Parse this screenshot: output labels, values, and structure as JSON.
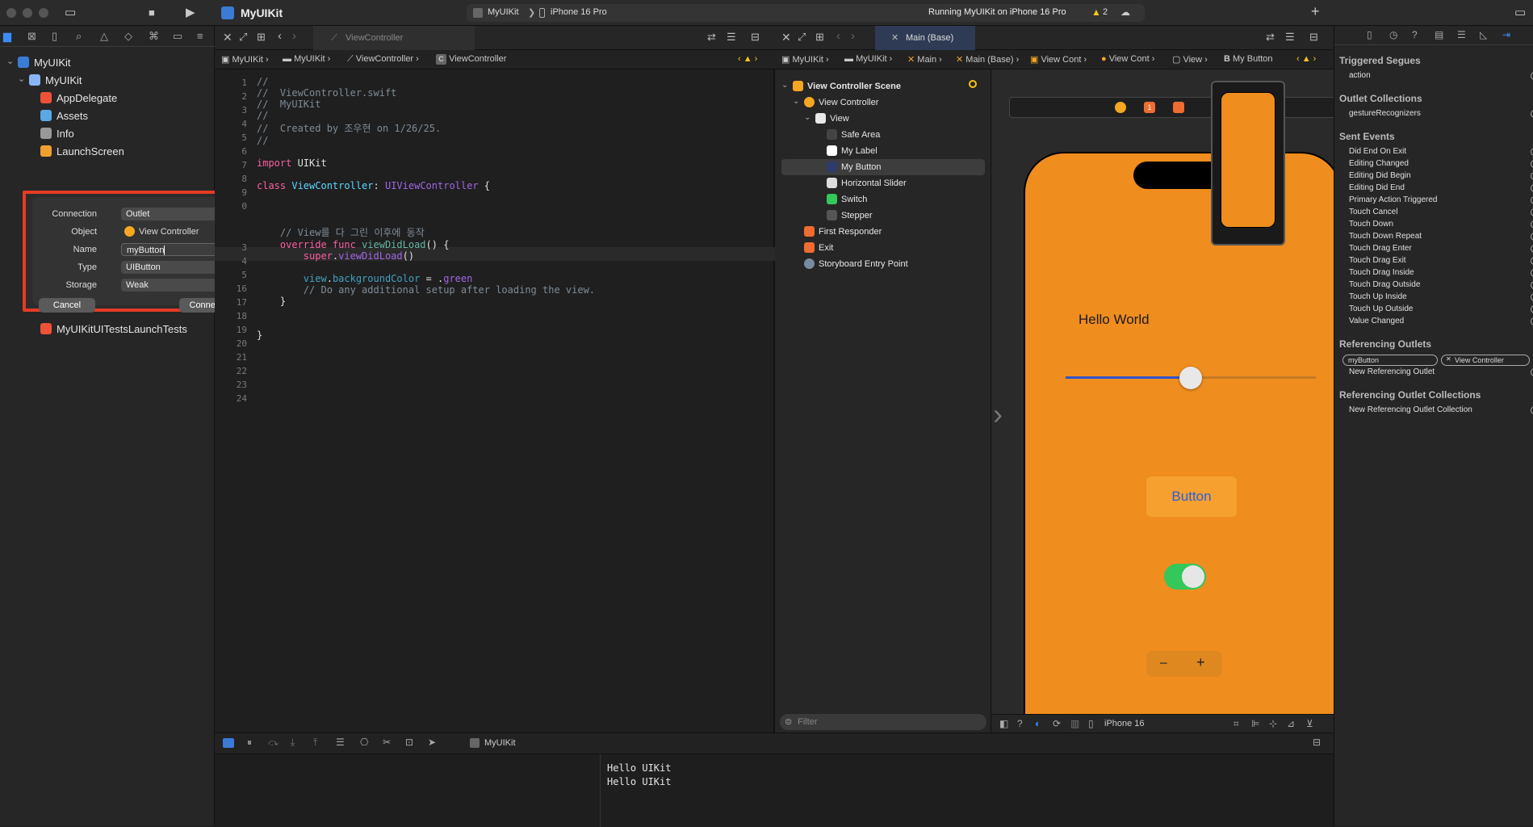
{
  "toolbar": {
    "project": "MyUIKit",
    "scheme": "MyUIKit",
    "device": "iPhone 16 Pro",
    "status": "Running MyUIKit on iPhone 16 Pro",
    "warnings": "2"
  },
  "navigator": {
    "items": [
      {
        "label": "MyUIKit",
        "icon": "project-icon",
        "color": "#3a7bd5"
      },
      {
        "label": "MyUIKit",
        "icon": "folder-icon",
        "color": "#8ab4f8"
      },
      {
        "label": "AppDelegate",
        "icon": "swift-icon",
        "color": "#f05138"
      },
      {
        "label": "Assets",
        "icon": "assets-icon",
        "color": "#5aa9e6"
      },
      {
        "label": "Info",
        "icon": "plist-icon",
        "color": "#999999"
      },
      {
        "label": "LaunchScreen",
        "icon": "storyboard-icon",
        "color": "#f0a030"
      },
      {
        "label": "MyUIKitUITestsLaunchTests",
        "icon": "swift-icon",
        "color": "#f05138"
      }
    ]
  },
  "popup": {
    "connection_label": "Connection",
    "connection_value": "Outlet",
    "object_label": "Object",
    "object_value": "View Controller",
    "name_label": "Name",
    "name_value": "myButton",
    "type_label": "Type",
    "type_value": "UIButton",
    "storage_label": "Storage",
    "storage_value": "Weak",
    "cancel": "Cancel",
    "connect": "Connect"
  },
  "editor": {
    "tab": "ViewController",
    "breadcrumb": [
      "MyUIKit",
      "MyUIKit",
      "ViewController",
      "ViewController"
    ],
    "line_numbers": [
      "1",
      "2",
      "3",
      "4",
      "5",
      "6",
      "7",
      "8",
      "9",
      "0",
      "",
      "",
      "3",
      "4",
      "5",
      "16",
      "17",
      "18",
      "19",
      "20",
      "21",
      "22",
      "23",
      "24"
    ]
  },
  "ib": {
    "tab": "Main (Base)",
    "breadcrumb": [
      "MyUIKit",
      "MyUIKit",
      "Main",
      "Main (Base)",
      "View Cont",
      "View Cont",
      "View",
      "My Button"
    ],
    "outline": [
      {
        "label": "View Controller Scene",
        "indent": 0,
        "bold": true
      },
      {
        "label": "View Controller",
        "indent": 1
      },
      {
        "label": "View",
        "indent": 2
      },
      {
        "label": "Safe Area",
        "indent": 3
      },
      {
        "label": "My Label",
        "indent": 3
      },
      {
        "label": "My Button",
        "indent": 3,
        "selected": true
      },
      {
        "label": "Horizontal Slider",
        "indent": 3
      },
      {
        "label": "Switch",
        "indent": 3
      },
      {
        "label": "Stepper",
        "indent": 3
      },
      {
        "label": "First Responder",
        "indent": 1
      },
      {
        "label": "Exit",
        "indent": 1
      },
      {
        "label": "Storyboard Entry Point",
        "indent": 1
      }
    ],
    "filter_placeholder": "Filter",
    "label_text": "Hello World",
    "button_text": "Button",
    "slider_value": 0.5,
    "switch_on": true,
    "stepper_minus": "−",
    "stepper_plus": "+",
    "device_label": "iPhone 16",
    "accent": "#ef8d1e"
  },
  "inspector": {
    "sections": [
      {
        "title": "Triggered Segues",
        "rows": [
          "action"
        ]
      },
      {
        "title": "Outlet Collections",
        "rows": [
          "gestureRecognizers"
        ]
      },
      {
        "title": "Sent Events",
        "rows": [
          "Did End On Exit",
          "Editing Changed",
          "Editing Did Begin",
          "Editing Did End",
          "Primary Action Triggered",
          "Touch Cancel",
          "Touch Down",
          "Touch Down Repeat",
          "Touch Drag Enter",
          "Touch Drag Exit",
          "Touch Drag Inside",
          "Touch Drag Outside",
          "Touch Up Inside",
          "Touch Up Outside",
          "Value Changed"
        ]
      },
      {
        "title": "Referencing Outlets",
        "rows": [
          "New Referencing Outlet"
        ]
      },
      {
        "title": "Referencing Outlet Collections",
        "rows": [
          "New Referencing Outlet Collection"
        ]
      }
    ],
    "outlet_name": "myButton",
    "outlet_target": "View Controller"
  },
  "debug": {
    "target": "MyUIKit",
    "console": [
      "Hello UIKit",
      "Hello UIKit"
    ]
  }
}
